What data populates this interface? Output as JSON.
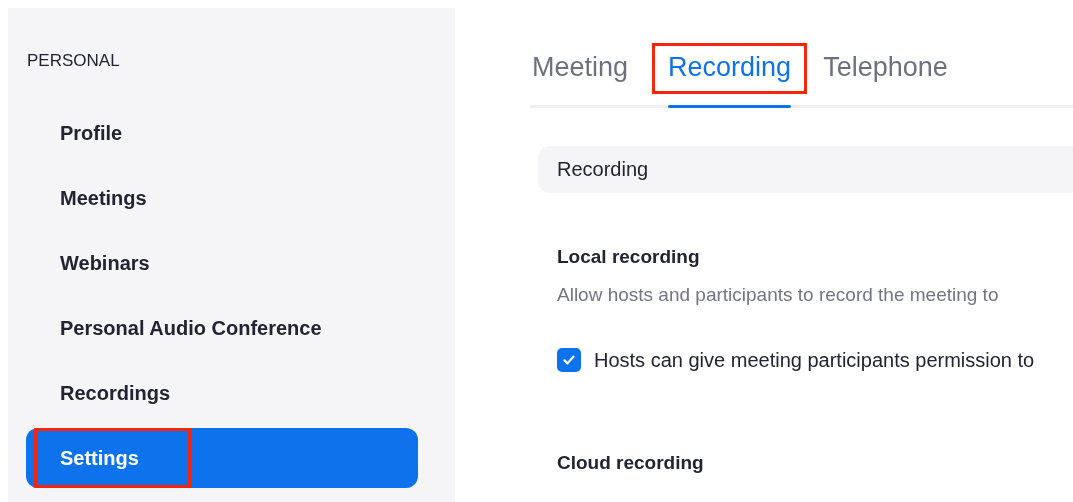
{
  "sidebar": {
    "section": "PERSONAL",
    "items": [
      {
        "label": "Profile",
        "selected": false,
        "highlighted": false
      },
      {
        "label": "Meetings",
        "selected": false,
        "highlighted": false
      },
      {
        "label": "Webinars",
        "selected": false,
        "highlighted": false
      },
      {
        "label": "Personal Audio Conference",
        "selected": false,
        "highlighted": false
      },
      {
        "label": "Recordings",
        "selected": false,
        "highlighted": false
      },
      {
        "label": "Settings",
        "selected": true,
        "highlighted": true
      }
    ]
  },
  "tabs": [
    {
      "label": "Meeting",
      "selected": false,
      "highlighted": false
    },
    {
      "label": "Recording",
      "selected": true,
      "highlighted": true
    },
    {
      "label": "Telephone",
      "selected": false,
      "highlighted": false
    }
  ],
  "section_header": "Recording",
  "settings": [
    {
      "title": "Local recording",
      "description": "Allow hosts and participants to record the meeting to",
      "options": [
        {
          "label": "Hosts can give meeting participants permission to",
          "checked": true
        }
      ]
    },
    {
      "title": "Cloud recording"
    }
  ]
}
